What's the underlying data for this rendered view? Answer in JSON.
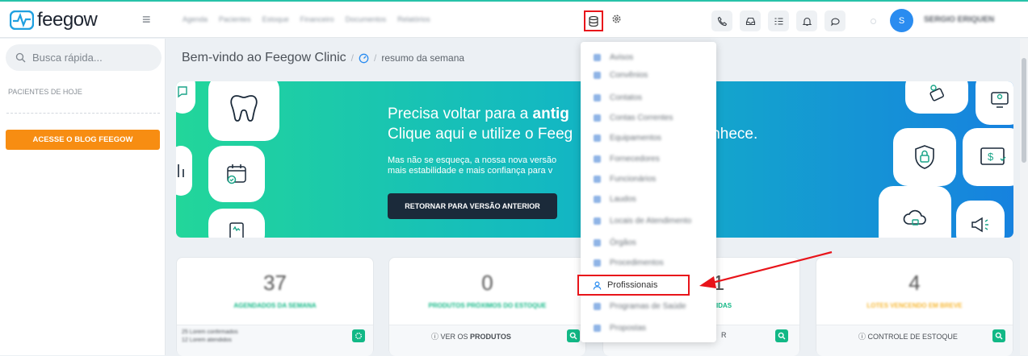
{
  "app": {
    "logo_text": "feegow"
  },
  "topnav": {
    "items": [
      "Agenda",
      "Pacientes",
      "Estoque",
      "Financeiro",
      "Documentos",
      "Relatórios"
    ]
  },
  "user": {
    "name": "SERGIO ERIQUEN",
    "initial": "S"
  },
  "sidebar": {
    "search_placeholder": "Busca rápida...",
    "section_title": "PACIENTES DE HOJE",
    "blog_button": "ACESSE O BLOG FEEGOW"
  },
  "breadcrumb": {
    "title": "Bem-vindo ao Feegow Clinic",
    "separator": "/",
    "current": "resumo da semana"
  },
  "banner": {
    "line1_prefix": "Precisa voltar para a ",
    "line1_bold": "antig",
    "line2_prefix": "Clique aqui e utilize o Feeg",
    "line2_suffix": "nhece.",
    "body1": "Mas não se esqueça, a nossa nova versão",
    "body2": "mais estabilidade e mais confiança para v",
    "button": "RETORNAR PARA VERSÃO ANTERIOR"
  },
  "cards": [
    {
      "number": "37",
      "label": "AGENDADOS DA SEMANA",
      "label_color": "#12b886",
      "foot1": "25 Lorem confirmados",
      "foot2": "12 Lorem atendidos"
    },
    {
      "number": "0",
      "label": "PRODUTOS PRÓXIMOS DO ESTOQUE",
      "label_color": "#12b886",
      "foot_prefix": "VER OS ",
      "foot_bold": "PRODUTOS"
    },
    {
      "number": "1",
      "label": "PENDÊNCIAS",
      "visible_label": "IDAS",
      "label_color": "#12b886",
      "foot_prefix": "",
      "foot_bold": "R"
    },
    {
      "number": "4",
      "label": "LOTES VENCENDO EM BREVE",
      "label_color": "#f7b731",
      "foot_prefix": "CONTROLE DE ESTOQUE",
      "foot_bold": ""
    }
  ],
  "dropdown": {
    "items": [
      "Avisos",
      "Convênios",
      "Contatos",
      "Contas Correntes",
      "Equipamentos",
      "Fornecedores",
      "Funcionários",
      "Laudos",
      "Locais de Atendimento",
      "Órgãos",
      "Procedimentos"
    ],
    "highlighted": "Profissionais",
    "after": [
      "Programas de Saúde",
      "Propostas"
    ]
  },
  "colors": {
    "accent": "#12b886",
    "orange": "#f78d12",
    "highlight": "#e8141a",
    "avatar": "#2a8cf0"
  }
}
